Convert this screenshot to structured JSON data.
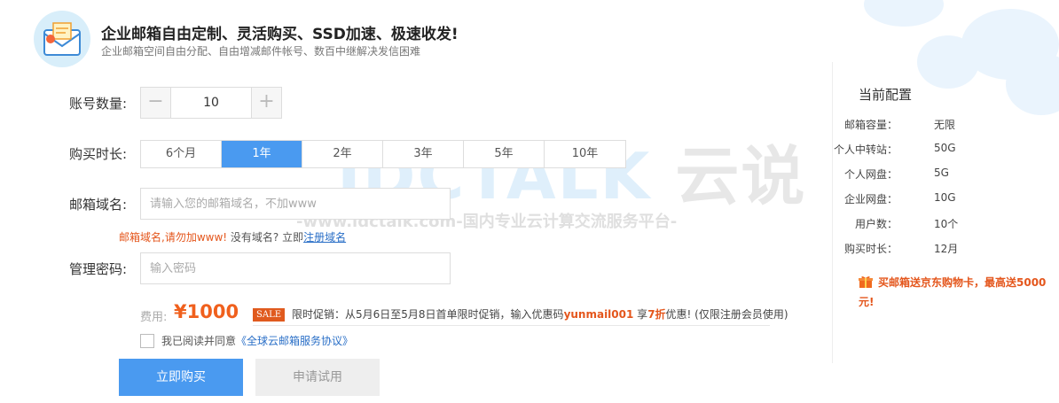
{
  "header": {
    "title": "企业邮箱自由定制、灵活购买、SSD加速、极速收发!",
    "subtitle": "企业邮箱空间自由分配、自由增减邮件帐号、数百中继解决发信困难"
  },
  "form": {
    "accounts": {
      "label": "账号数量:",
      "minus": "−",
      "value": "10",
      "plus": "+"
    },
    "duration": {
      "label": "购买时长:",
      "options": [
        "6个月",
        "1年",
        "2年",
        "3年",
        "5年",
        "10年"
      ],
      "selected": "1年"
    },
    "domain": {
      "label": "邮箱域名:",
      "placeholder": "请输入您的邮箱域名，不加www",
      "hint_warn": "邮箱域名,请勿加www!",
      "hint_text": " 没有域名? 立即",
      "hint_link": "注册域名"
    },
    "password": {
      "label": "管理密码:",
      "placeholder": "输入密码"
    },
    "fee": {
      "label": "费用:",
      "value": "¥1000"
    },
    "promo": {
      "tag": "SALE",
      "text_prefix": "限时促销：从5月6日至5月8日首单限时促销，输入优惠码",
      "code": "yunmail001",
      "text_mid": " 享",
      "discount": "7折",
      "text_suffix": "优惠! (仅限注册会员使用)"
    },
    "agree": {
      "text": "我已阅读并同意",
      "link": "《全球云邮箱服务协议》"
    },
    "buy_button": "立即购买",
    "trial_button": "申请试用"
  },
  "watermark": {
    "logo_text": "IDCTALK",
    "logo_cn": "云说",
    "tagline": "-www.idctalk.com-国内专业云计算交流服务平台-"
  },
  "config": {
    "title": "当前配置",
    "rows": [
      {
        "key": "邮箱容量：",
        "value": "无限"
      },
      {
        "key": "个人中转站：",
        "value": "50G"
      },
      {
        "key": "个人网盘：",
        "value": "5G"
      },
      {
        "key": "企业网盘：",
        "value": "10G"
      },
      {
        "key": "用户数：",
        "value": "10个"
      },
      {
        "key": "购买时长：",
        "value": "12月"
      }
    ],
    "gift_text": "买邮箱送京东购物卡，最高送5000元!"
  },
  "colors": {
    "accent": "#4a9af0",
    "warn": "#e4561c",
    "link": "#2a6fc7"
  },
  "icons": [
    "mail-envelope-icon",
    "gift-icon",
    "minus-icon",
    "plus-icon",
    "checkbox-icon"
  ]
}
